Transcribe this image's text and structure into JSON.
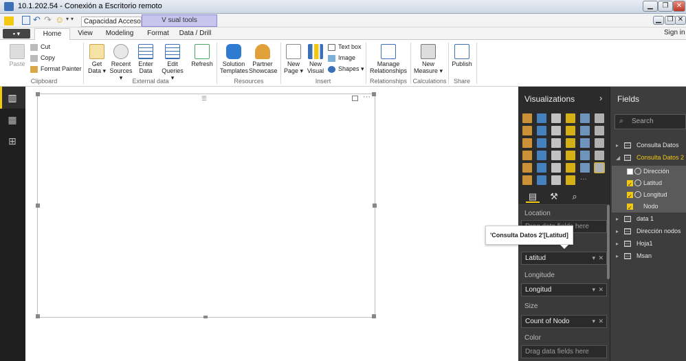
{
  "rdp": {
    "title": "10.1.202.54 - Conexión a Escritorio remoto",
    "minimize": "▁",
    "restore": "❐",
    "close": "✕"
  },
  "titlebar": {
    "doc_title": "Capacidad Acceso ...",
    "visual_tools": "V sual tools",
    "sign_in": "Sign in"
  },
  "tabs": [
    {
      "label": "Home"
    },
    {
      "label": "View"
    },
    {
      "label": "Modeling"
    },
    {
      "label": "Format"
    },
    {
      "label": "Data / Drill"
    }
  ],
  "ribbon": {
    "paste": "Paste",
    "cut": "Cut",
    "copy": "Copy",
    "format_painter": "Format Painter",
    "get_data": "Get Data",
    "recent_sources": "Recent Sources",
    "enter_data": "Enter Data",
    "edit_queries": "Edit Queries",
    "refresh": "Refresh",
    "solution_templates": "Solution Templates",
    "partner_showcase": "Partner Showcase",
    "new_page": "New Page",
    "new_visual": "New Visual",
    "text_box": "Text box",
    "image": "Image",
    "shapes": "Shapes",
    "manage_relationships": "Manage Relationships",
    "new_measure": "New Measure",
    "publish": "Publish",
    "groups": {
      "clipboard": "Clipboard",
      "external_data": "External data",
      "resources": "Resources",
      "insert": "Insert",
      "relationships": "Relationships",
      "calculations": "Calculations",
      "share": "Share"
    }
  },
  "visualizations": {
    "title": "Visualizations",
    "wells": {
      "location_label": "Location",
      "location_drop": "Drag data fields here",
      "latitude_value": "Latitud",
      "longitude_label": "Longitude",
      "longitude_value": "Longitud",
      "size_label": "Size",
      "size_value": "Count of Nodo",
      "color_label": "Color",
      "color_drop": "Drag data fields here"
    }
  },
  "fields": {
    "title": "Fields",
    "search_placeholder": "Search",
    "tables": [
      {
        "name": "Consulta Datos"
      },
      {
        "name": "Consulta Datos 2"
      },
      {
        "name": "data 1"
      },
      {
        "name": "Dirección nodos"
      },
      {
        "name": "Hoja1"
      },
      {
        "name": "Msan"
      }
    ],
    "items": [
      {
        "name": "Dirección",
        "checked": false
      },
      {
        "name": "Latitud",
        "checked": true
      },
      {
        "name": "Longitud",
        "checked": true
      },
      {
        "name": "Nodo",
        "checked": true
      }
    ]
  },
  "tooltip": {
    "text": "'Consulta Datos 2'[Latitud]"
  },
  "colors": {
    "accent_yellow": "#f2c811",
    "pane_dark": "#2b2b2b",
    "visual_tools": "#c7c4ee"
  }
}
